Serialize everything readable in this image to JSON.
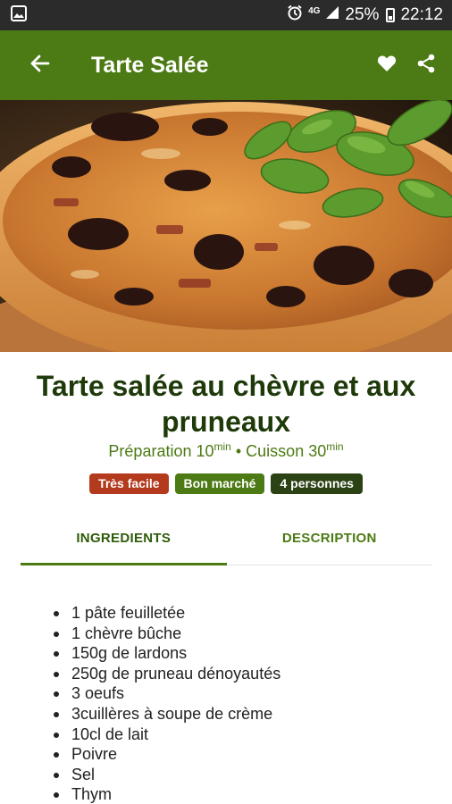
{
  "status_bar": {
    "network": "4G",
    "battery": "25%",
    "time": "22:12",
    "icons": [
      "gallery-icon",
      "alarm-icon",
      "signal-icon",
      "battery-icon"
    ]
  },
  "app_bar": {
    "title": "Tarte Salée",
    "icons": [
      "back-arrow-icon",
      "heart-icon",
      "share-icon"
    ],
    "color": "#4c7a14"
  },
  "recipe": {
    "title": "Tarte salée au chèvre et aux pruneaux",
    "prep_label": "Préparation 10",
    "prep_unit": "min",
    "cook_label": "Cuisson 30",
    "cook_unit": "min",
    "separator": " • ",
    "badges": {
      "difficulty": "Très facile",
      "cost": "Bon marché",
      "servings": "4 personnes"
    }
  },
  "tabs": {
    "ingredients": "INGREDIENTS",
    "description": "DESCRIPTION",
    "active": "ingredients"
  },
  "ingredients": [
    "1 pâte feuilletée",
    "1 chèvre bûche",
    "150g de lardons",
    "250g de pruneau dénoyautés",
    "3 oeufs",
    "3cuillères à soupe de crème",
    "10cl de lait",
    "Poivre",
    "Sel",
    "Thym"
  ],
  "colors": {
    "accent": "#4c7a14",
    "title": "#1f3a0a",
    "badge_easy": "#b43a1e",
    "badge_cheap": "#4c7a14",
    "badge_people": "#2b4215"
  }
}
